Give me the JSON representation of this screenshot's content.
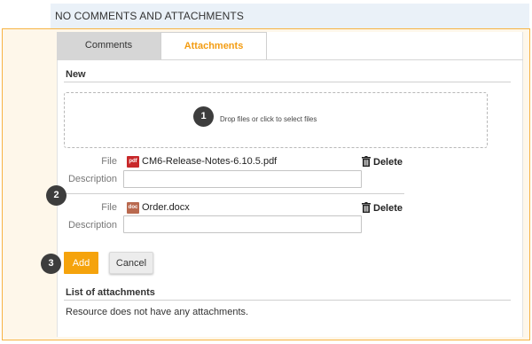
{
  "header": {
    "title": "NO COMMENTS AND ATTACHMENTS"
  },
  "tabs": [
    {
      "label": "Comments",
      "active": false
    },
    {
      "label": "Attachments",
      "active": true
    }
  ],
  "new_section": {
    "title": "New",
    "dropzone_text": "Drop files or click to select files"
  },
  "badges": [
    "1",
    "2",
    "3"
  ],
  "files": [
    {
      "file_label": "File",
      "icon_text": "pdf",
      "name": "CM6-Release-Notes-6.10.5.pdf",
      "delete_label": "Delete",
      "description_label": "Description",
      "description_value": ""
    },
    {
      "file_label": "File",
      "icon_text": "doc",
      "name": "Order.docx",
      "delete_label": "Delete",
      "description_label": "Description",
      "description_value": ""
    }
  ],
  "buttons": {
    "add": "Add",
    "cancel": "Cancel"
  },
  "list_section": {
    "title": "List of attachments",
    "empty_message": "Resource does not have any attachments."
  },
  "colors": {
    "accent": "#f5a30c",
    "frame_border": "#f7b343",
    "header_bg": "#eaf1f8",
    "pdf_icon": "#c8282a",
    "doc_icon": "#b9694f"
  }
}
